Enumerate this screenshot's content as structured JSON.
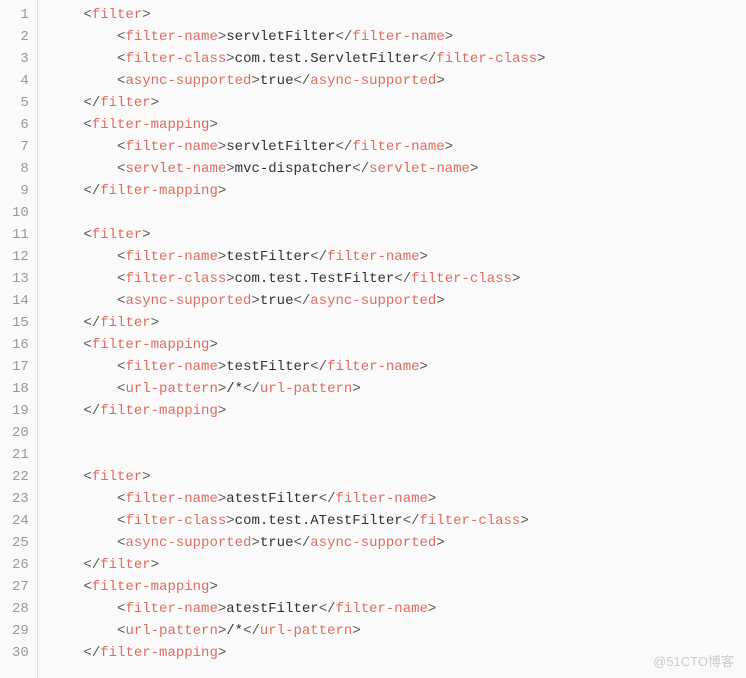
{
  "watermark": "@51CTO博客",
  "lines": [
    {
      "num": 1,
      "indent": 1,
      "tokens": [
        {
          "t": "punct",
          "v": "<"
        },
        {
          "t": "tag",
          "v": "filter"
        },
        {
          "t": "punct",
          "v": ">"
        }
      ]
    },
    {
      "num": 2,
      "indent": 2,
      "tokens": [
        {
          "t": "punct",
          "v": "<"
        },
        {
          "t": "tag",
          "v": "filter-name"
        },
        {
          "t": "punct",
          "v": ">"
        },
        {
          "t": "txt",
          "v": "servletFilter"
        },
        {
          "t": "punct",
          "v": "</"
        },
        {
          "t": "tag",
          "v": "filter-name"
        },
        {
          "t": "punct",
          "v": ">"
        }
      ]
    },
    {
      "num": 3,
      "indent": 2,
      "tokens": [
        {
          "t": "punct",
          "v": "<"
        },
        {
          "t": "tag",
          "v": "filter-class"
        },
        {
          "t": "punct",
          "v": ">"
        },
        {
          "t": "txt",
          "v": "com.test.ServletFilter"
        },
        {
          "t": "punct",
          "v": "</"
        },
        {
          "t": "tag",
          "v": "filter-class"
        },
        {
          "t": "punct",
          "v": ">"
        }
      ]
    },
    {
      "num": 4,
      "indent": 2,
      "tokens": [
        {
          "t": "punct",
          "v": "<"
        },
        {
          "t": "tag",
          "v": "async-supported"
        },
        {
          "t": "punct",
          "v": ">"
        },
        {
          "t": "txt",
          "v": "true"
        },
        {
          "t": "punct",
          "v": "</"
        },
        {
          "t": "tag",
          "v": "async-supported"
        },
        {
          "t": "punct",
          "v": ">"
        }
      ]
    },
    {
      "num": 5,
      "indent": 1,
      "tokens": [
        {
          "t": "punct",
          "v": "</"
        },
        {
          "t": "tag",
          "v": "filter"
        },
        {
          "t": "punct",
          "v": ">"
        }
      ]
    },
    {
      "num": 6,
      "indent": 1,
      "tokens": [
        {
          "t": "punct",
          "v": "<"
        },
        {
          "t": "tag",
          "v": "filter-mapping"
        },
        {
          "t": "punct",
          "v": ">"
        }
      ]
    },
    {
      "num": 7,
      "indent": 2,
      "tokens": [
        {
          "t": "punct",
          "v": "<"
        },
        {
          "t": "tag",
          "v": "filter-name"
        },
        {
          "t": "punct",
          "v": ">"
        },
        {
          "t": "txt",
          "v": "servletFilter"
        },
        {
          "t": "punct",
          "v": "</"
        },
        {
          "t": "tag",
          "v": "filter-name"
        },
        {
          "t": "punct",
          "v": ">"
        }
      ]
    },
    {
      "num": 8,
      "indent": 2,
      "tokens": [
        {
          "t": "punct",
          "v": "<"
        },
        {
          "t": "tag",
          "v": "servlet-name"
        },
        {
          "t": "punct",
          "v": ">"
        },
        {
          "t": "txt",
          "v": "mvc-dispatcher"
        },
        {
          "t": "punct",
          "v": "</"
        },
        {
          "t": "tag",
          "v": "servlet-name"
        },
        {
          "t": "punct",
          "v": ">"
        }
      ]
    },
    {
      "num": 9,
      "indent": 1,
      "tokens": [
        {
          "t": "punct",
          "v": "</"
        },
        {
          "t": "tag",
          "v": "filter-mapping"
        },
        {
          "t": "punct",
          "v": ">"
        }
      ]
    },
    {
      "num": 10,
      "indent": 0,
      "tokens": []
    },
    {
      "num": 11,
      "indent": 1,
      "tokens": [
        {
          "t": "punct",
          "v": "<"
        },
        {
          "t": "tag",
          "v": "filter"
        },
        {
          "t": "punct",
          "v": ">"
        }
      ]
    },
    {
      "num": 12,
      "indent": 2,
      "tokens": [
        {
          "t": "punct",
          "v": "<"
        },
        {
          "t": "tag",
          "v": "filter-name"
        },
        {
          "t": "punct",
          "v": ">"
        },
        {
          "t": "txt",
          "v": "testFilter"
        },
        {
          "t": "punct",
          "v": "</"
        },
        {
          "t": "tag",
          "v": "filter-name"
        },
        {
          "t": "punct",
          "v": ">"
        }
      ]
    },
    {
      "num": 13,
      "indent": 2,
      "tokens": [
        {
          "t": "punct",
          "v": "<"
        },
        {
          "t": "tag",
          "v": "filter-class"
        },
        {
          "t": "punct",
          "v": ">"
        },
        {
          "t": "txt",
          "v": "com.test.TestFilter"
        },
        {
          "t": "punct",
          "v": "</"
        },
        {
          "t": "tag",
          "v": "filter-class"
        },
        {
          "t": "punct",
          "v": ">"
        }
      ]
    },
    {
      "num": 14,
      "indent": 2,
      "tokens": [
        {
          "t": "punct",
          "v": "<"
        },
        {
          "t": "tag",
          "v": "async-supported"
        },
        {
          "t": "punct",
          "v": ">"
        },
        {
          "t": "txt",
          "v": "true"
        },
        {
          "t": "punct",
          "v": "</"
        },
        {
          "t": "tag",
          "v": "async-supported"
        },
        {
          "t": "punct",
          "v": ">"
        }
      ]
    },
    {
      "num": 15,
      "indent": 1,
      "tokens": [
        {
          "t": "punct",
          "v": "</"
        },
        {
          "t": "tag",
          "v": "filter"
        },
        {
          "t": "punct",
          "v": ">"
        }
      ]
    },
    {
      "num": 16,
      "indent": 1,
      "tokens": [
        {
          "t": "punct",
          "v": "<"
        },
        {
          "t": "tag",
          "v": "filter-mapping"
        },
        {
          "t": "punct",
          "v": ">"
        }
      ]
    },
    {
      "num": 17,
      "indent": 2,
      "tokens": [
        {
          "t": "punct",
          "v": "<"
        },
        {
          "t": "tag",
          "v": "filter-name"
        },
        {
          "t": "punct",
          "v": ">"
        },
        {
          "t": "txt",
          "v": "testFilter"
        },
        {
          "t": "punct",
          "v": "</"
        },
        {
          "t": "tag",
          "v": "filter-name"
        },
        {
          "t": "punct",
          "v": ">"
        }
      ]
    },
    {
      "num": 18,
      "indent": 2,
      "tokens": [
        {
          "t": "punct",
          "v": "<"
        },
        {
          "t": "tag",
          "v": "url-pattern"
        },
        {
          "t": "punct",
          "v": ">"
        },
        {
          "t": "txt",
          "v": "/*"
        },
        {
          "t": "punct",
          "v": "</"
        },
        {
          "t": "tag",
          "v": "url-pattern"
        },
        {
          "t": "punct",
          "v": ">"
        }
      ]
    },
    {
      "num": 19,
      "indent": 1,
      "tokens": [
        {
          "t": "punct",
          "v": "</"
        },
        {
          "t": "tag",
          "v": "filter-mapping"
        },
        {
          "t": "punct",
          "v": ">"
        }
      ]
    },
    {
      "num": 20,
      "indent": 0,
      "tokens": []
    },
    {
      "num": 21,
      "indent": 0,
      "tokens": []
    },
    {
      "num": 22,
      "indent": 1,
      "tokens": [
        {
          "t": "punct",
          "v": "<"
        },
        {
          "t": "tag",
          "v": "filter"
        },
        {
          "t": "punct",
          "v": ">"
        }
      ]
    },
    {
      "num": 23,
      "indent": 2,
      "tokens": [
        {
          "t": "punct",
          "v": "<"
        },
        {
          "t": "tag",
          "v": "filter-name"
        },
        {
          "t": "punct",
          "v": ">"
        },
        {
          "t": "txt",
          "v": "atestFilter"
        },
        {
          "t": "punct",
          "v": "</"
        },
        {
          "t": "tag",
          "v": "filter-name"
        },
        {
          "t": "punct",
          "v": ">"
        }
      ]
    },
    {
      "num": 24,
      "indent": 2,
      "tokens": [
        {
          "t": "punct",
          "v": "<"
        },
        {
          "t": "tag",
          "v": "filter-class"
        },
        {
          "t": "punct",
          "v": ">"
        },
        {
          "t": "txt",
          "v": "com.test.ATestFilter"
        },
        {
          "t": "punct",
          "v": "</"
        },
        {
          "t": "tag",
          "v": "filter-class"
        },
        {
          "t": "punct",
          "v": ">"
        }
      ]
    },
    {
      "num": 25,
      "indent": 2,
      "tokens": [
        {
          "t": "punct",
          "v": "<"
        },
        {
          "t": "tag",
          "v": "async-supported"
        },
        {
          "t": "punct",
          "v": ">"
        },
        {
          "t": "txt",
          "v": "true"
        },
        {
          "t": "punct",
          "v": "</"
        },
        {
          "t": "tag",
          "v": "async-supported"
        },
        {
          "t": "punct",
          "v": ">"
        }
      ]
    },
    {
      "num": 26,
      "indent": 1,
      "tokens": [
        {
          "t": "punct",
          "v": "</"
        },
        {
          "t": "tag",
          "v": "filter"
        },
        {
          "t": "punct",
          "v": ">"
        }
      ]
    },
    {
      "num": 27,
      "indent": 1,
      "tokens": [
        {
          "t": "punct",
          "v": "<"
        },
        {
          "t": "tag",
          "v": "filter-mapping"
        },
        {
          "t": "punct",
          "v": ">"
        }
      ]
    },
    {
      "num": 28,
      "indent": 2,
      "tokens": [
        {
          "t": "punct",
          "v": "<"
        },
        {
          "t": "tag",
          "v": "filter-name"
        },
        {
          "t": "punct",
          "v": ">"
        },
        {
          "t": "txt",
          "v": "atestFilter"
        },
        {
          "t": "punct",
          "v": "</"
        },
        {
          "t": "tag",
          "v": "filter-name"
        },
        {
          "t": "punct",
          "v": ">"
        }
      ]
    },
    {
      "num": 29,
      "indent": 2,
      "tokens": [
        {
          "t": "punct",
          "v": "<"
        },
        {
          "t": "tag",
          "v": "url-pattern"
        },
        {
          "t": "punct",
          "v": ">"
        },
        {
          "t": "txt",
          "v": "/*"
        },
        {
          "t": "punct",
          "v": "</"
        },
        {
          "t": "tag",
          "v": "url-pattern"
        },
        {
          "t": "punct",
          "v": ">"
        }
      ]
    },
    {
      "num": 30,
      "indent": 1,
      "tokens": [
        {
          "t": "punct",
          "v": "</"
        },
        {
          "t": "tag",
          "v": "filter-mapping"
        },
        {
          "t": "punct",
          "v": ">"
        }
      ]
    }
  ]
}
